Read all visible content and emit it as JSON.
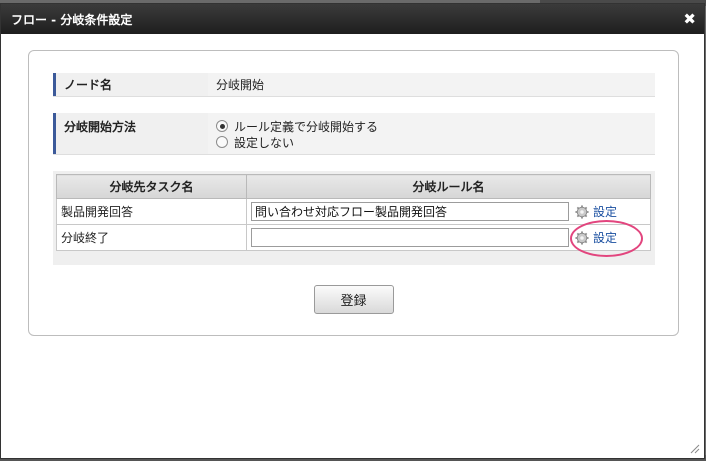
{
  "dialog": {
    "title": "フロー - 分岐条件設定",
    "close_glyph": "✖"
  },
  "node": {
    "label": "ノード名",
    "value": "分岐開始"
  },
  "method": {
    "label": "分岐開始方法",
    "options": [
      {
        "label": "ルール定義で分岐開始する",
        "checked": true
      },
      {
        "label": "設定しない",
        "checked": false
      }
    ]
  },
  "table": {
    "headers": [
      "分岐先タスク名",
      "分岐ルール名"
    ],
    "rows": [
      {
        "task": "製品開発回答",
        "rule": "問い合わせ対応フロー製品開発回答",
        "link": "設定"
      },
      {
        "task": "分岐終了",
        "rule": "",
        "link": "設定"
      }
    ]
  },
  "actions": {
    "register_label": "登録"
  },
  "colors": {
    "accent": "#3c5a9a",
    "link": "#1a4fa0",
    "highlight": "#e2457e"
  }
}
